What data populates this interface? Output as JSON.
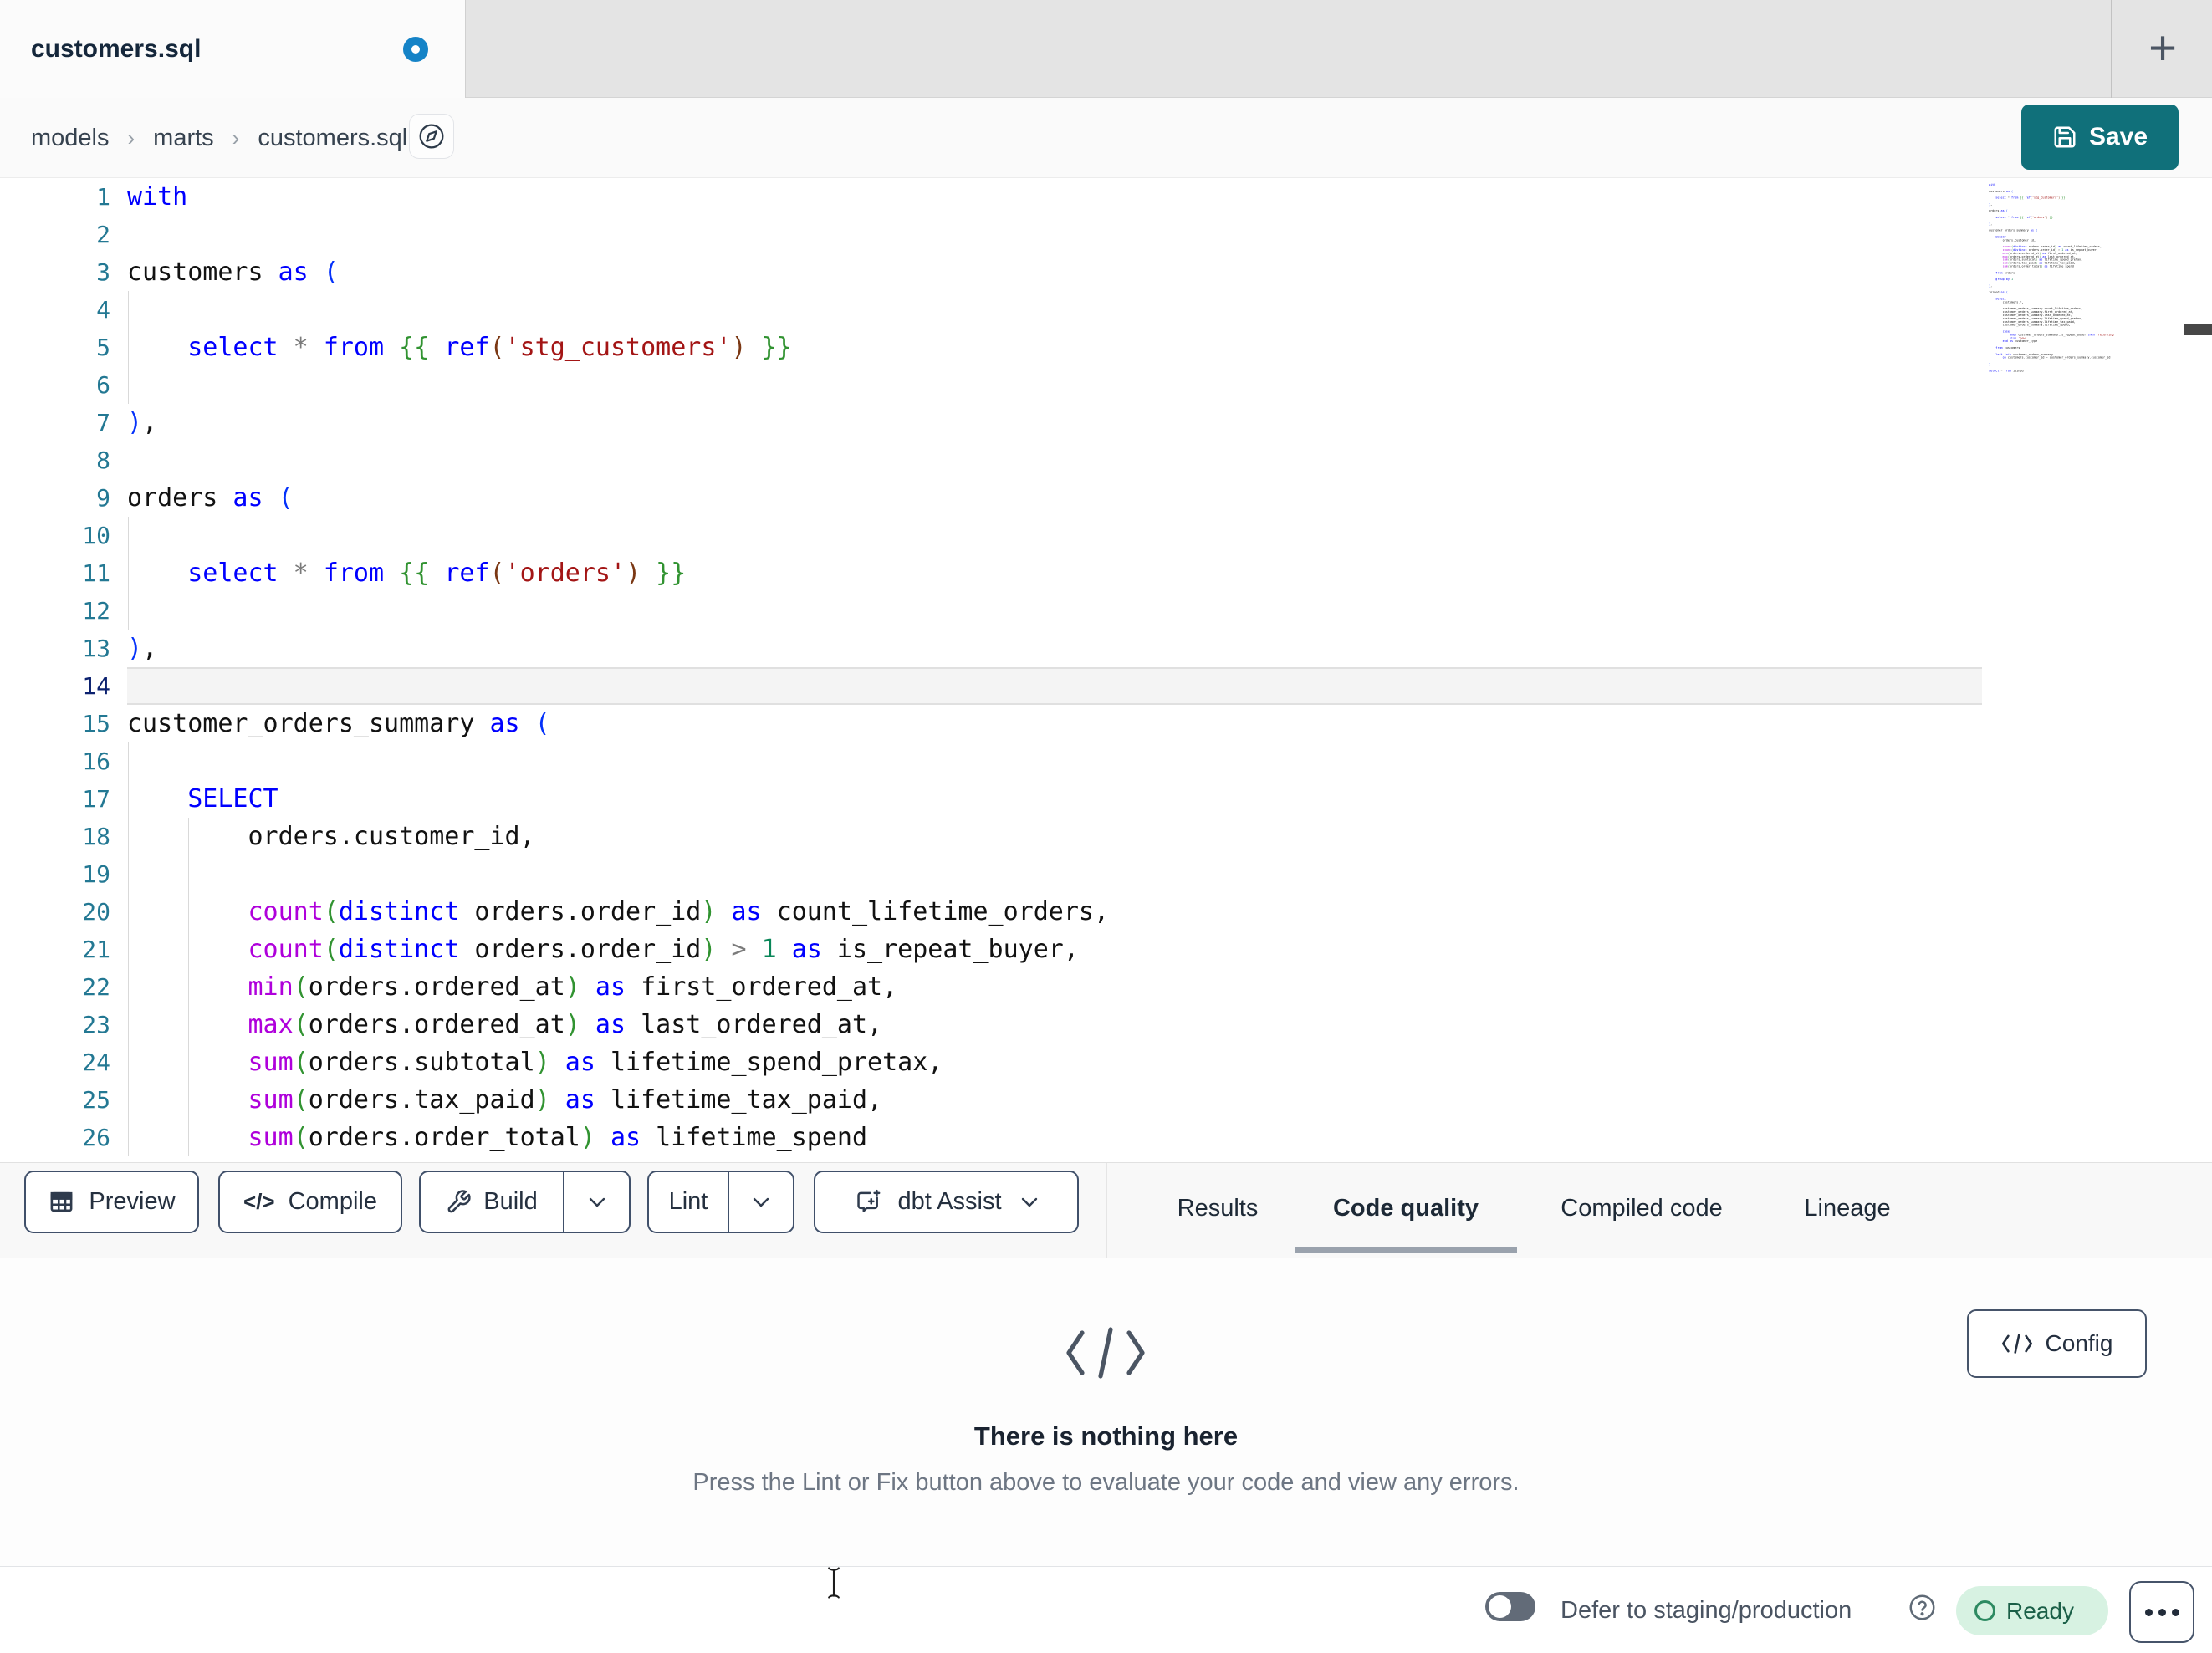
{
  "tab": {
    "title": "customers.sql",
    "unsaved": true,
    "new_tab_label": "+"
  },
  "breadcrumb": {
    "items": [
      "models",
      "marts",
      "customers.sql"
    ],
    "separator": "›"
  },
  "save": {
    "label": "Save"
  },
  "colors": {
    "accent_teal": "#10707a",
    "unsaved_dot_blue": "#1583c7",
    "ready_green_bg": "#d7f2e2",
    "ready_green_text": "#1a5f47",
    "keyword_blue": "#0000ff",
    "function_magenta": "#af00db",
    "string_red": "#a31515",
    "number_green": "#098658"
  },
  "editor": {
    "active_line": 14,
    "guides": {
      "4": [
        0
      ],
      "5": [
        0
      ],
      "6": [
        0
      ],
      "10": [
        0
      ],
      "11": [
        0
      ],
      "12": [
        0
      ],
      "16": [
        0
      ],
      "17": [
        0
      ],
      "18": [
        0,
        1
      ],
      "19": [
        0,
        1
      ],
      "20": [
        0,
        1
      ],
      "21": [
        0,
        1
      ],
      "22": [
        0,
        1
      ],
      "23": [
        0,
        1
      ],
      "24": [
        0,
        1
      ],
      "25": [
        0,
        1
      ],
      "26": [
        0,
        1
      ]
    },
    "lines": [
      [
        [
          "kw",
          "with"
        ]
      ],
      [],
      [
        [
          "id",
          "customers"
        ],
        [
          "kw",
          " as "
        ],
        [
          "b1",
          "("
        ]
      ],
      [],
      [
        [
          "sp",
          "    "
        ],
        [
          "kw",
          "select"
        ],
        [
          "op",
          " * "
        ],
        [
          "kw",
          "from"
        ],
        [
          "sp",
          " "
        ],
        [
          "b2",
          "{{ "
        ],
        [
          "kw",
          "ref"
        ],
        [
          "b3",
          "("
        ],
        [
          "str",
          "'stg_customers'"
        ],
        [
          "b3",
          ")"
        ],
        [
          "b2",
          " }}"
        ]
      ],
      [],
      [
        [
          "b1",
          ")"
        ],
        [
          "pn",
          ","
        ]
      ],
      [],
      [
        [
          "id",
          "orders"
        ],
        [
          "kw",
          " as "
        ],
        [
          "b1",
          "("
        ]
      ],
      [],
      [
        [
          "sp",
          "    "
        ],
        [
          "kw",
          "select"
        ],
        [
          "op",
          " * "
        ],
        [
          "kw",
          "from"
        ],
        [
          "sp",
          " "
        ],
        [
          "b2",
          "{{ "
        ],
        [
          "kw",
          "ref"
        ],
        [
          "b3",
          "("
        ],
        [
          "str",
          "'orders'"
        ],
        [
          "b3",
          ")"
        ],
        [
          "b2",
          " }}"
        ]
      ],
      [],
      [
        [
          "b1",
          ")"
        ],
        [
          "pn",
          ","
        ]
      ],
      [],
      [
        [
          "id",
          "customer_orders_summary"
        ],
        [
          "kw",
          " as "
        ],
        [
          "b1",
          "("
        ]
      ],
      [],
      [
        [
          "sp",
          "    "
        ],
        [
          "kw",
          "SELECT"
        ]
      ],
      [
        [
          "sp",
          "        "
        ],
        [
          "id",
          "orders.customer_id"
        ],
        [
          "pn",
          ","
        ]
      ],
      [],
      [
        [
          "sp",
          "        "
        ],
        [
          "fn",
          "count"
        ],
        [
          "b2",
          "("
        ],
        [
          "kw",
          "distinct"
        ],
        [
          "id",
          " orders.order_id"
        ],
        [
          "b2",
          ")"
        ],
        [
          "kw",
          " as"
        ],
        [
          "id",
          " count_lifetime_orders"
        ],
        [
          "pn",
          ","
        ]
      ],
      [
        [
          "sp",
          "        "
        ],
        [
          "fn",
          "count"
        ],
        [
          "b2",
          "("
        ],
        [
          "kw",
          "distinct"
        ],
        [
          "id",
          " orders.order_id"
        ],
        [
          "b2",
          ")"
        ],
        [
          "op",
          " > "
        ],
        [
          "num",
          "1"
        ],
        [
          "kw",
          " as"
        ],
        [
          "id",
          " is_repeat_buyer"
        ],
        [
          "pn",
          ","
        ]
      ],
      [
        [
          "sp",
          "        "
        ],
        [
          "fn",
          "min"
        ],
        [
          "b2",
          "("
        ],
        [
          "id",
          "orders.ordered_at"
        ],
        [
          "b2",
          ")"
        ],
        [
          "kw",
          " as"
        ],
        [
          "id",
          " first_ordered_at"
        ],
        [
          "pn",
          ","
        ]
      ],
      [
        [
          "sp",
          "        "
        ],
        [
          "fn",
          "max"
        ],
        [
          "b2",
          "("
        ],
        [
          "id",
          "orders.ordered_at"
        ],
        [
          "b2",
          ")"
        ],
        [
          "kw",
          " as"
        ],
        [
          "id",
          " last_ordered_at"
        ],
        [
          "pn",
          ","
        ]
      ],
      [
        [
          "sp",
          "        "
        ],
        [
          "fn",
          "sum"
        ],
        [
          "b2",
          "("
        ],
        [
          "id",
          "orders.subtotal"
        ],
        [
          "b2",
          ")"
        ],
        [
          "kw",
          " as"
        ],
        [
          "id",
          " lifetime_spend_pretax"
        ],
        [
          "pn",
          ","
        ]
      ],
      [
        [
          "sp",
          "        "
        ],
        [
          "fn",
          "sum"
        ],
        [
          "b2",
          "("
        ],
        [
          "id",
          "orders.tax_paid"
        ],
        [
          "b2",
          ")"
        ],
        [
          "kw",
          " as"
        ],
        [
          "id",
          " lifetime_tax_paid"
        ],
        [
          "pn",
          ","
        ]
      ],
      [
        [
          "sp",
          "        "
        ],
        [
          "fn",
          "sum"
        ],
        [
          "b2",
          "("
        ],
        [
          "id",
          "orders.order_total"
        ],
        [
          "b2",
          ")"
        ],
        [
          "kw",
          " as"
        ],
        [
          "id",
          " lifetime_spend"
        ]
      ]
    ],
    "minimap_extra": [
      [],
      [
        [
          "sp",
          "    "
        ],
        [
          "kw",
          "from"
        ],
        [
          "id",
          " orders"
        ]
      ],
      [],
      [
        [
          "sp",
          "    "
        ],
        [
          "kw",
          "group by"
        ],
        [
          "num",
          " 1"
        ]
      ],
      [],
      [
        [
          "b1",
          ")"
        ],
        [
          "pn",
          ","
        ]
      ],
      [],
      [
        [
          "id",
          "joined"
        ],
        [
          "kw",
          " as "
        ],
        [
          "b1",
          "("
        ]
      ],
      [],
      [
        [
          "sp",
          "    "
        ],
        [
          "kw",
          "select"
        ]
      ],
      [
        [
          "sp",
          "        "
        ],
        [
          "id",
          "customers"
        ],
        [
          "op",
          ".*"
        ],
        [
          "pn",
          ","
        ]
      ],
      [],
      [
        [
          "sp",
          "        "
        ],
        [
          "id",
          "customer_orders_summary.count_lifetime_orders"
        ],
        [
          "pn",
          ","
        ]
      ],
      [
        [
          "sp",
          "        "
        ],
        [
          "id",
          "customer_orders_summary.first_ordered_at"
        ],
        [
          "pn",
          ","
        ]
      ],
      [
        [
          "sp",
          "        "
        ],
        [
          "id",
          "customer_orders_summary.last_ordered_at"
        ],
        [
          "pn",
          ","
        ]
      ],
      [
        [
          "sp",
          "        "
        ],
        [
          "id",
          "customer_orders_summary.lifetime_spend_pretax"
        ],
        [
          "pn",
          ","
        ]
      ],
      [
        [
          "sp",
          "        "
        ],
        [
          "id",
          "customer_orders_summary.lifetime_tax_paid"
        ],
        [
          "pn",
          ","
        ]
      ],
      [
        [
          "sp",
          "        "
        ],
        [
          "id",
          "customer_orders_summary.lifetime_spend"
        ],
        [
          "pn",
          ","
        ]
      ],
      [],
      [
        [
          "sp",
          "        "
        ],
        [
          "kw",
          "case"
        ]
      ],
      [
        [
          "sp",
          "            "
        ],
        [
          "kw",
          "when"
        ],
        [
          "id",
          " customer_orders_summary.is_repeat_buyer"
        ],
        [
          "kw",
          " then"
        ],
        [
          "str",
          " 'returning'"
        ]
      ],
      [
        [
          "sp",
          "            "
        ],
        [
          "kw",
          "else"
        ],
        [
          "str",
          " 'new'"
        ]
      ],
      [
        [
          "sp",
          "        "
        ],
        [
          "kw",
          "end as"
        ],
        [
          "id",
          " customer_type"
        ]
      ],
      [],
      [
        [
          "sp",
          "    "
        ],
        [
          "kw",
          "from"
        ],
        [
          "id",
          " customers"
        ]
      ],
      [],
      [
        [
          "sp",
          "    "
        ],
        [
          "kw",
          "left join"
        ],
        [
          "id",
          " customer_orders_summary"
        ]
      ],
      [
        [
          "sp",
          "        "
        ],
        [
          "kw",
          "on"
        ],
        [
          "id",
          " customers.customer_id"
        ],
        [
          "op",
          " = "
        ],
        [
          "id",
          "customer_orders_summary.customer_id"
        ]
      ],
      [],
      [
        [
          "b1",
          ")"
        ]
      ],
      [],
      [
        [
          "kw",
          "select"
        ],
        [
          "op",
          " * "
        ],
        [
          "kw",
          "from"
        ],
        [
          "id",
          " joined"
        ]
      ]
    ]
  },
  "toolbar": {
    "preview_label": "Preview",
    "compile_label": "Compile",
    "compile_glyph": "</>",
    "build_label": "Build",
    "lint_label": "Lint",
    "assist_label": "dbt Assist"
  },
  "panel_tabs": {
    "results": "Results",
    "code_quality": "Code quality",
    "compiled": "Compiled code",
    "lineage": "Lineage",
    "active": "Code quality"
  },
  "empty_state": {
    "title": "There is nothing here",
    "subtitle": "Press the Lint or Fix button above to evaluate your code and view any errors.",
    "config_label": "Config",
    "config_glyph": "</>"
  },
  "status_bar": {
    "defer_label": "Defer to staging/production",
    "defer_toggle_on": false,
    "ready_label": "Ready"
  }
}
